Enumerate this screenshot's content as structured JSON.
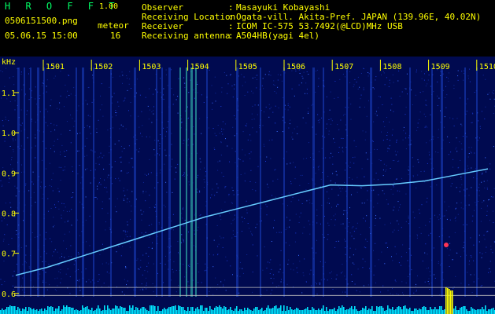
{
  "header": {
    "title": "H R O F F T",
    "version": "1.00",
    "file": "0506151500.png",
    "mode_label": "meteor",
    "datetime": "05.06.15 15:00",
    "count": "16"
  },
  "info": [
    {
      "label": "Observer",
      "value": "Masayuki Kobayashi"
    },
    {
      "label": "Receiving Location",
      "value": "Ogata-vill. Akita-Pref. JAPAN (139.96E, 40.02N)"
    },
    {
      "label": "Receiver",
      "value": "ICOM IC-575 53.7492(@LCD)MHz USB"
    },
    {
      "label": "Receiving antenna",
      "value": "A504HB(yagi 4el)"
    }
  ],
  "info_separator": ":",
  "axis": {
    "unit": "kHz",
    "y_ticks": [
      "1.1",
      "1.0",
      "0.9",
      "0.8",
      "0.7",
      "0.6"
    ],
    "x_ticks": [
      "1501",
      "1502",
      "1503",
      "1504",
      "1505",
      "1506",
      "1507",
      "1508",
      "1509",
      "1510"
    ]
  },
  "colors": {
    "background": "#000000",
    "plot_bg": "#000a50",
    "title_green": "#00ff66",
    "text_yellow": "#ffff00",
    "trace": "#66ccff",
    "baseline_bars": "#00e5ff",
    "peak_bar": "#ffff00"
  }
}
